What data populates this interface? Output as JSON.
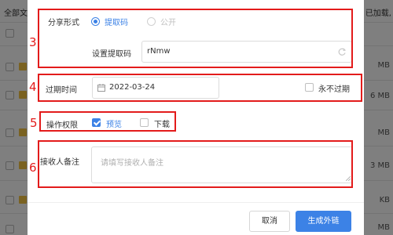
{
  "background": {
    "left_text": "全部文",
    "right_text": "已加载,",
    "sizes": [
      "MB",
      "6 MB",
      "MB",
      "3 MB",
      "KB",
      "MB"
    ]
  },
  "share_form": {
    "label": "分享形式",
    "options": [
      {
        "label": "提取码",
        "selected": true
      },
      {
        "label": "公开",
        "selected": false
      }
    ]
  },
  "extract_code": {
    "label": "设置提取码",
    "value": "rNmw",
    "refresh_icon": "refresh-icon"
  },
  "expiry": {
    "label": "过期时间",
    "date": "2022-03-24",
    "never_label": "永不过期",
    "never_checked": false,
    "calendar_icon": "calendar-icon"
  },
  "permissions": {
    "label": "操作权限",
    "preview_label": "预览",
    "preview_checked": true,
    "download_label": "下载",
    "download_checked": false
  },
  "note": {
    "label": "接收人备注",
    "placeholder": "请填写接收人备注"
  },
  "buttons": {
    "cancel": "取消",
    "generate": "生成外链"
  },
  "annotations": [
    "3",
    "4",
    "5",
    "6"
  ],
  "colors": {
    "accent": "#3c82e6",
    "annotation": "#e31b1b"
  }
}
